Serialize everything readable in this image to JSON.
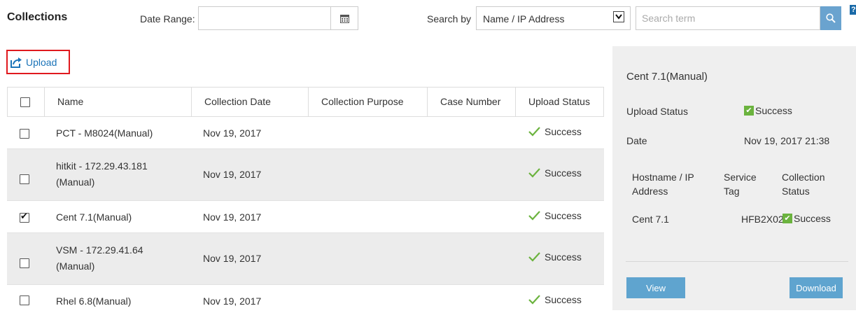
{
  "header": {
    "title": "Collections",
    "date_range_label": "Date Range:",
    "date_range_value": "",
    "search_by_label": "Search by",
    "search_by_selected": "Name / IP Address",
    "search_placeholder": "Search term",
    "search_value": ""
  },
  "toolbar": {
    "upload_label": "Upload"
  },
  "table": {
    "columns": [
      "Name",
      "Collection Date",
      "Collection Purpose",
      "Case Number",
      "Upload Status"
    ],
    "rows": [
      {
        "name_line1": "PCT - M8024(Manual)",
        "name_line2": "",
        "date": "Nov 19, 2017",
        "purpose": "",
        "case": "",
        "status": "Success",
        "checked": false
      },
      {
        "name_line1": "hitkit - 172.29.43.181",
        "name_line2": "(Manual)",
        "date": "Nov 19, 2017",
        "purpose": "",
        "case": "",
        "status": "Success",
        "checked": false
      },
      {
        "name_line1": "Cent 7.1(Manual)",
        "name_line2": "",
        "date": "Nov 19, 2017",
        "purpose": "",
        "case": "",
        "status": "Success",
        "checked": true
      },
      {
        "name_line1": "VSM - 172.29.41.64",
        "name_line2": "(Manual)",
        "date": "Nov 19, 2017",
        "purpose": "",
        "case": "",
        "status": "Success",
        "checked": false
      },
      {
        "name_line1": "Rhel 6.8(Manual)",
        "name_line2": "",
        "date": "Nov 19, 2017",
        "purpose": "",
        "case": "",
        "status": "Success",
        "checked": false
      }
    ]
  },
  "details": {
    "title": "Cent 7.1(Manual)",
    "upload_status_label": "Upload Status",
    "upload_status_value": "Success",
    "date_label": "Date",
    "date_value": "Nov 19, 2017 21:38",
    "sub_columns": {
      "host_line1": "Hostname / IP",
      "host_line2": "Address",
      "tag_line1": "Service",
      "tag_line2": "Tag",
      "status_line1": "Collection",
      "status_line2": "Status"
    },
    "sub_row": {
      "host": "Cent 7.1",
      "tag": "HFB2X02",
      "status": "Success"
    },
    "view_label": "View",
    "download_label": "Download"
  },
  "colors": {
    "accent": "#5fa4cf",
    "link": "#1a73b8",
    "success": "#6bb33e",
    "highlight_border": "#e0191e",
    "panel_bg": "#efefef",
    "row_alt": "#ececec"
  },
  "icons": {
    "calendar": "calendar-icon",
    "search": "search-icon",
    "upload": "upload-icon",
    "check": "check-icon",
    "help": "help-icon"
  }
}
